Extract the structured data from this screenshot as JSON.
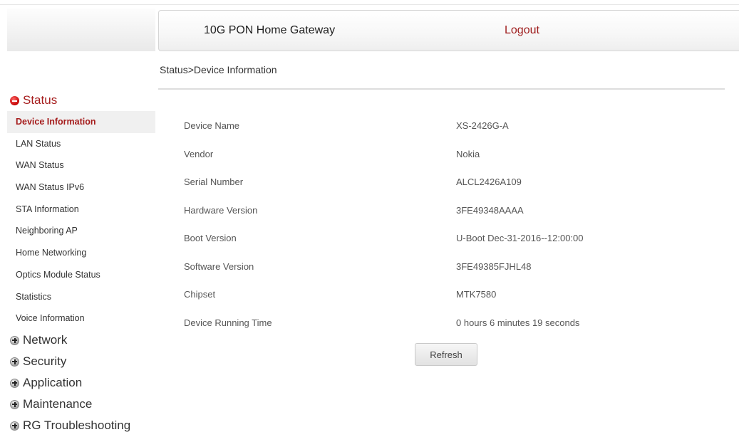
{
  "header": {
    "product_name": "10G PON Home Gateway",
    "logout_label": "Logout"
  },
  "breadcrumb": "Status>Device Information",
  "sidebar": {
    "status_section": "Status",
    "status_items": [
      {
        "label": "Device Information",
        "selected": true
      },
      {
        "label": "LAN Status"
      },
      {
        "label": "WAN Status"
      },
      {
        "label": "WAN Status IPv6"
      },
      {
        "label": "STA Information"
      },
      {
        "label": "Neighboring AP"
      },
      {
        "label": "Home Networking"
      },
      {
        "label": "Optics Module Status"
      },
      {
        "label": "Statistics"
      },
      {
        "label": "Voice Information"
      }
    ],
    "collapsed_sections": [
      "Network",
      "Security",
      "Application",
      "Maintenance",
      "RG Troubleshooting"
    ]
  },
  "device_info": [
    {
      "label": "Device Name",
      "value": "XS-2426G-A"
    },
    {
      "label": "Vendor",
      "value": "Nokia"
    },
    {
      "label": "Serial Number",
      "value": "ALCL2426A109"
    },
    {
      "label": "Hardware Version",
      "value": "3FE49348AAAA"
    },
    {
      "label": "Boot Version",
      "value": "U-Boot Dec-31-2016--12:00:00"
    },
    {
      "label": "Software Version",
      "value": "3FE49385FJHL48"
    },
    {
      "label": "Chipset",
      "value": "MTK7580"
    },
    {
      "label": "Device Running Time",
      "value": "0 hours 6 minutes 19 seconds"
    }
  ],
  "refresh_label": "Refresh",
  "icons": {
    "expanded": "minus-circle-icon",
    "collapsed": "plus-circle-icon"
  },
  "colors": {
    "accent": "#a51c1c",
    "text": "#555555"
  }
}
